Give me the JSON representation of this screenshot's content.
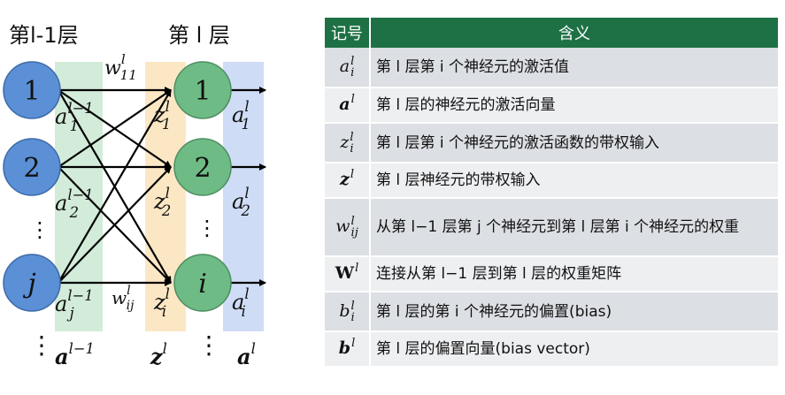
{
  "diagram": {
    "layer_prev_title": "第l-1层",
    "layer_curr_title": "第 l 层",
    "nodes_prev": [
      "1",
      "2",
      "j"
    ],
    "nodes_curr": [
      "1",
      "2",
      "i"
    ],
    "ellipsis": "⋮",
    "weight_w11": "w",
    "weight_w11_sub": "11",
    "weight_w11_sup": "l",
    "weight_wij": "w",
    "weight_wij_sub": "ij",
    "weight_wij_sup": "l",
    "prev_acts": [
      {
        "base": "a",
        "sub": "1",
        "sup": "l−1"
      },
      {
        "base": "a",
        "sub": "2",
        "sup": "l−1"
      },
      {
        "base": "a",
        "sub": "j",
        "sup": "l−1"
      }
    ],
    "z_vals": [
      {
        "base": "z",
        "sub": "1",
        "sup": "l"
      },
      {
        "base": "z",
        "sub": "2",
        "sup": "l"
      },
      {
        "base": "z",
        "sub": "i",
        "sup": "l"
      }
    ],
    "curr_acts": [
      {
        "base": "a",
        "sub": "1",
        "sup": "l"
      },
      {
        "base": "a",
        "sub": "2",
        "sup": "l"
      },
      {
        "base": "a",
        "sub": "i",
        "sup": "l"
      }
    ],
    "bottom_prev": {
      "base": "a",
      "sup": "l−1"
    },
    "bottom_z": {
      "base": "z",
      "sup": "l"
    },
    "bottom_curr": {
      "base": "a",
      "sup": "l"
    },
    "colors": {
      "node_prev_fill": "#5b8fd6",
      "node_curr_fill": "#6fbb85",
      "band_prev": "#d2ecd9",
      "band_z": "#fbe7c4",
      "band_curr": "#cfdcf6"
    }
  },
  "table": {
    "header_symbol": "记号",
    "header_meaning": "含义",
    "rows": [
      {
        "base": "a",
        "sub": "i",
        "sup": "l",
        "bold": false,
        "meaning": "第 l 层第 i 个神经元的激活值"
      },
      {
        "base": "a",
        "sub": "",
        "sup": "l",
        "bold": true,
        "meaning": "第 l 层的神经元的激活向量"
      },
      {
        "base": "z",
        "sub": "i",
        "sup": "l",
        "bold": false,
        "meaning": "第 l 层第 i 个神经元的激活函数的带权输入"
      },
      {
        "base": "z",
        "sub": "",
        "sup": "l",
        "bold": true,
        "meaning": "第 l 层神经元的带权输入"
      },
      {
        "base": "w",
        "sub": "ij",
        "sup": "l",
        "bold": false,
        "meaning": "从第 l−1 层第 j 个神经元到第 l 层第 i 个神经元的权重"
      },
      {
        "base": "W",
        "sub": "",
        "sup": "l",
        "bold": true,
        "meaning": "连接从第 l−1 层到第 l 层的权重矩阵"
      },
      {
        "base": "b",
        "sub": "i",
        "sup": "l",
        "bold": false,
        "meaning": "第 l 层的第 i 个神经元的偏置(bias)"
      },
      {
        "base": "b",
        "sub": "",
        "sup": "l",
        "bold": true,
        "meaning": "第 l 层的偏置向量(bias vector)"
      }
    ],
    "header_color": "#1e7145"
  }
}
